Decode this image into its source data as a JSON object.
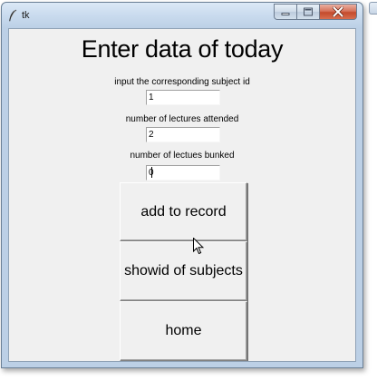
{
  "window": {
    "title": "tk"
  },
  "caption_buttons": {
    "minimize_icon": "minimize-icon",
    "maximize_icon": "maximize-icon",
    "close_icon": "close-icon"
  },
  "form": {
    "heading": "Enter data of today",
    "fields": [
      {
        "label": "input the corresponding subject id",
        "value": "1"
      },
      {
        "label": "number of lectures attended",
        "value": "2"
      },
      {
        "label": "number of lectues bunked",
        "value": "0"
      }
    ]
  },
  "buttons": {
    "add_label": "add to record",
    "show_label": "showid of subjects",
    "home_label": "home"
  },
  "colors": {
    "client_background": "#f0f0f0",
    "title_bar": "#bcd0e6",
    "close_button": "#c44a2c"
  }
}
